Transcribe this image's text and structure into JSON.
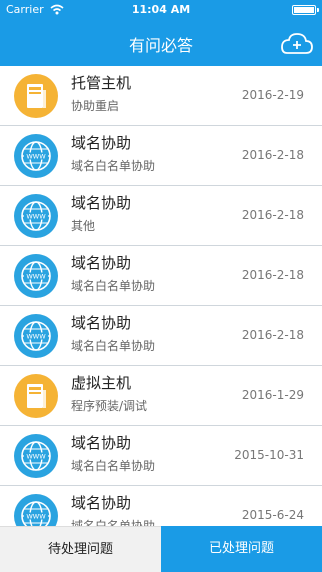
{
  "status": {
    "carrier": "Carrier",
    "time": "11:04 AM"
  },
  "nav": {
    "title": "有问必答"
  },
  "items": [
    {
      "title": "托管主机",
      "subtitle": "协助重启",
      "date": "2016-2-19",
      "icon": "server-icon"
    },
    {
      "title": "域名协助",
      "subtitle": "域名白名单协助",
      "date": "2016-2-18",
      "icon": "globe-icon"
    },
    {
      "title": "域名协助",
      "subtitle": "其他",
      "date": "2016-2-18",
      "icon": "globe-icon"
    },
    {
      "title": "域名协助",
      "subtitle": "域名白名单协助",
      "date": "2016-2-18",
      "icon": "globe-icon"
    },
    {
      "title": "域名协助",
      "subtitle": "域名白名单协助",
      "date": "2016-2-18",
      "icon": "globe-icon"
    },
    {
      "title": "虚拟主机",
      "subtitle": "程序预装/调试",
      "date": "2016-1-29",
      "icon": "server-icon"
    },
    {
      "title": "域名协助",
      "subtitle": "域名白名单协助",
      "date": "2015-10-31",
      "icon": "globe-icon"
    },
    {
      "title": "域名协助",
      "subtitle": "域名白名单协助",
      "date": "2015-6-24",
      "icon": "globe-icon"
    }
  ],
  "tabs": {
    "pending": "待处理问题",
    "done": "已处理问题"
  },
  "colors": {
    "primary": "#1a9be6",
    "server": "#f5b335",
    "globe": "#2aa3e0"
  }
}
